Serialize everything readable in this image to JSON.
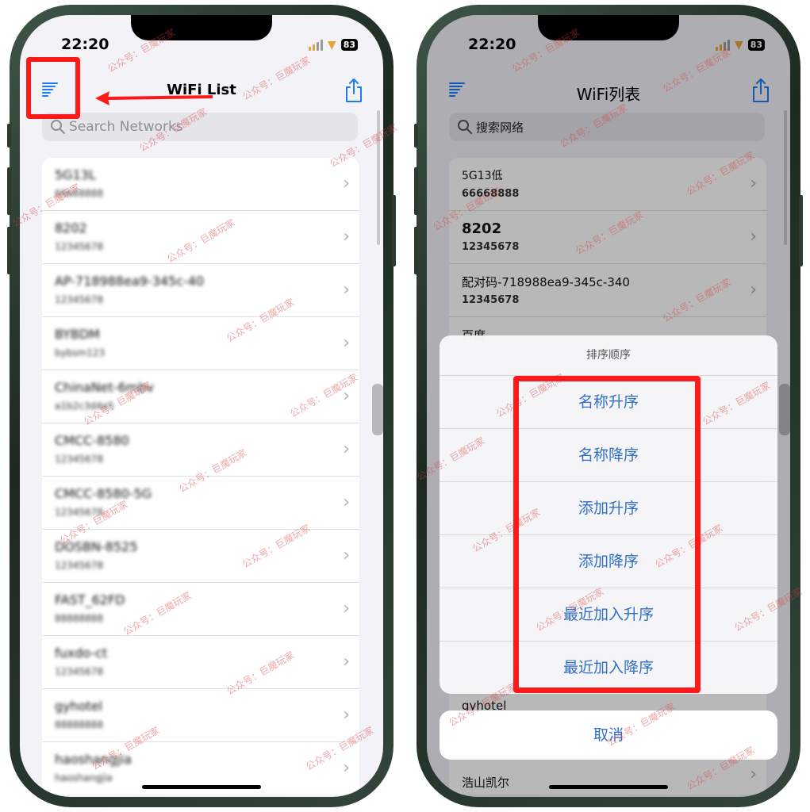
{
  "left": {
    "status": {
      "time": "22:20",
      "battery": "83"
    },
    "nav": {
      "title": "WiFi List"
    },
    "search": {
      "placeholder": "Search Networks"
    },
    "networks": [
      {
        "name": "5G13L",
        "password": "66668888"
      },
      {
        "name": "8202",
        "password": "12345678"
      },
      {
        "name": "AP-718988ea9-345c-40",
        "password": "12345678"
      },
      {
        "name": "BYBDM",
        "password": "bybsm123"
      },
      {
        "name": "ChinaNet-6mbv",
        "password": "a1b2c3d4e5"
      },
      {
        "name": "CMCC-8580",
        "password": "12345678"
      },
      {
        "name": "CMCC-8580-5G",
        "password": "12345678"
      },
      {
        "name": "DOSBN-8525",
        "password": "12345678"
      },
      {
        "name": "FAST_62FD",
        "password": "88888888"
      },
      {
        "name": "fuxdo-ct",
        "password": "12345678"
      },
      {
        "name": "gyhotel",
        "password": "88888888"
      },
      {
        "name": "haoshangjia",
        "password": "haoshangjia"
      }
    ]
  },
  "right": {
    "status": {
      "time": "22:20",
      "battery": "83"
    },
    "nav": {
      "title": "WiFi列表"
    },
    "search": {
      "placeholder": "搜索网络"
    },
    "networks": [
      {
        "name": "5G13低",
        "password": "66668888"
      },
      {
        "name": "8202",
        "password": "12345678"
      },
      {
        "name": "配对码-718988ea9-345c-340",
        "password": "12345678"
      },
      {
        "name": "百度",
        "password": ""
      }
    ],
    "peek_rows": [
      {
        "name": "gyhotel"
      },
      {
        "name": "浩山凯尔"
      }
    ],
    "sort_sheet": {
      "title": "排序顺序",
      "options": [
        "名称升序",
        "名称降序",
        "添加升序",
        "添加降序",
        "最近加入升序",
        "最近加入降序"
      ],
      "cancel": "取消"
    }
  },
  "watermark": "公众号：巨魔玩家",
  "colors": {
    "accent": "#2f6ec9",
    "highlight": "#ff1a1a",
    "icon": "#1e7cf2"
  }
}
